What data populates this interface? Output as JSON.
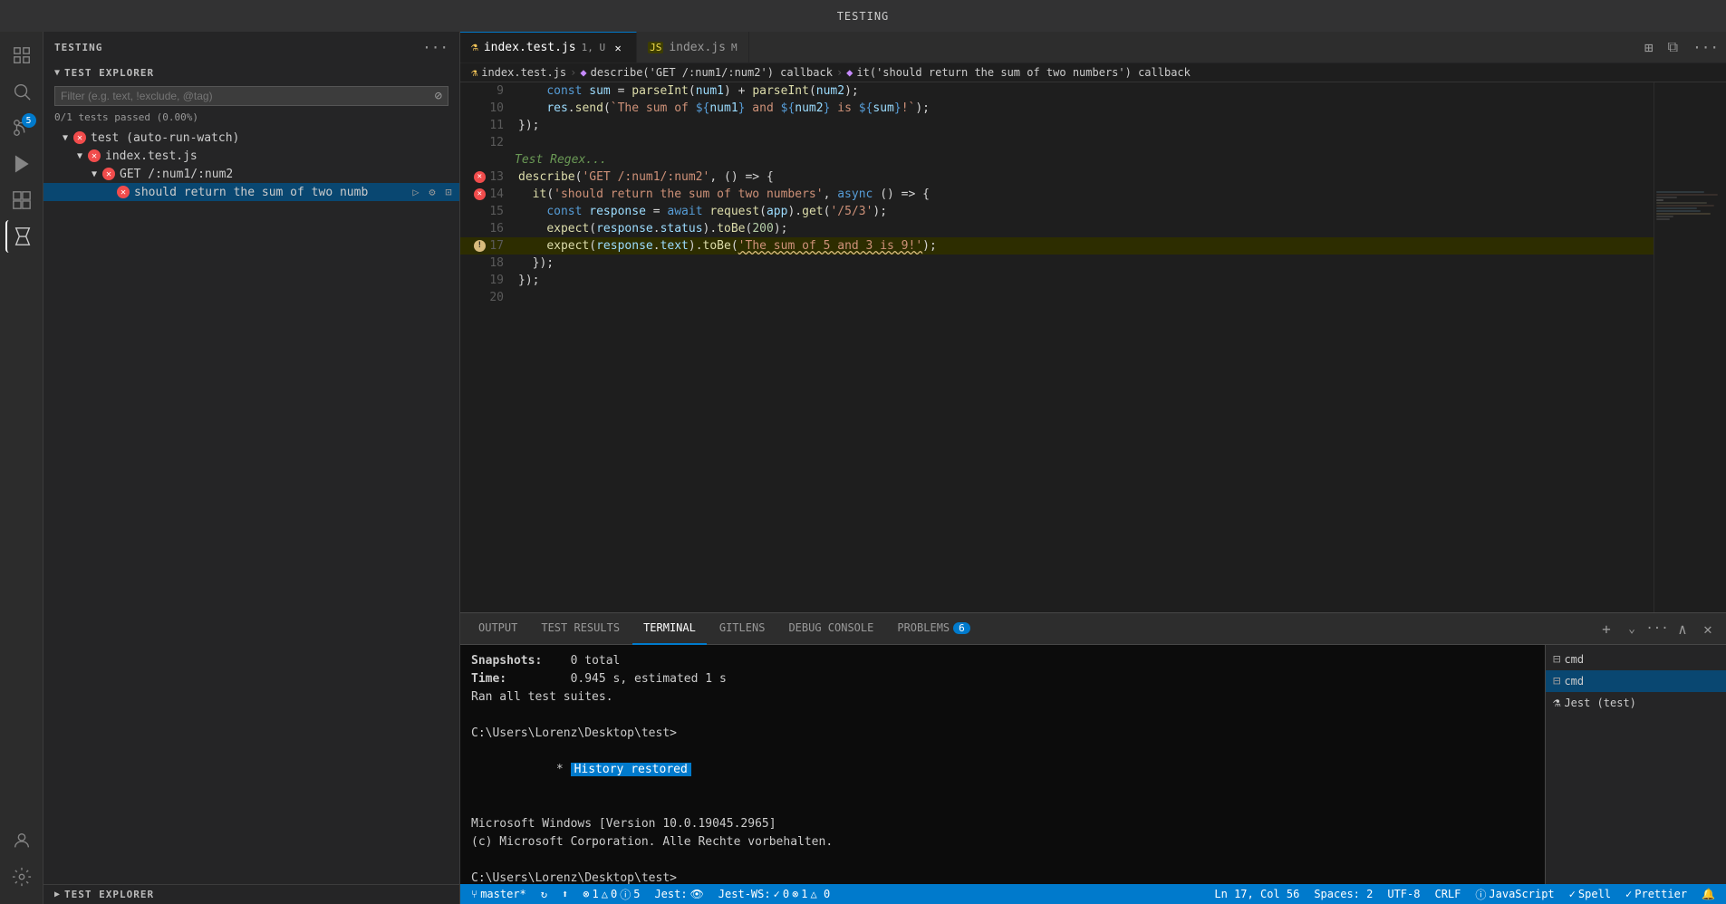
{
  "titleBar": {
    "title": "TESTING"
  },
  "activityBar": {
    "icons": [
      {
        "name": "explorer-icon",
        "symbol": "⬡",
        "active": false
      },
      {
        "name": "search-icon",
        "symbol": "🔍",
        "active": false
      },
      {
        "name": "source-control-icon",
        "symbol": "⑂",
        "active": false
      },
      {
        "name": "debug-icon",
        "symbol": "▷",
        "active": false
      },
      {
        "name": "extensions-icon",
        "symbol": "⊞",
        "active": false
      },
      {
        "name": "testing-icon",
        "symbol": "⚗",
        "active": true
      }
    ],
    "badge": "5"
  },
  "sidebar": {
    "header": "TESTING",
    "testExplorerTitle": "TEST EXPLORER",
    "filterPlaceholder": "Filter (e.g. text, !exclude, @tag)",
    "testStats": "0/1 tests passed (0.00%)",
    "tree": [
      {
        "id": "test-root",
        "label": "test  (auto-run-watch)",
        "level": 1,
        "hasArrow": true,
        "arrowDown": true,
        "hasError": true
      },
      {
        "id": "index-test",
        "label": "index.test.js",
        "level": 2,
        "hasArrow": true,
        "arrowDown": true,
        "hasError": true
      },
      {
        "id": "get-route",
        "label": "GET /:num1/:num2",
        "level": 3,
        "hasArrow": true,
        "arrowDown": true,
        "hasError": true
      },
      {
        "id": "should-return",
        "label": "should return the sum of two numb",
        "level": 4,
        "hasArrow": false,
        "hasError": true,
        "selected": true,
        "hasActions": true
      }
    ],
    "testExplorerFooterTitle": "TEST EXPLORER"
  },
  "tabs": [
    {
      "id": "index-test-tab",
      "label": "index.test.js",
      "dirty": false,
      "modified": true,
      "active": true,
      "icon": "⚗",
      "iconColor": "#f9c859",
      "close": true,
      "badge": "1, U"
    },
    {
      "id": "index-js-tab",
      "label": "index.js",
      "dirty": false,
      "modified": true,
      "active": false,
      "icon": "JS",
      "iconColor": "#f0dc4e",
      "close": false,
      "badge": "M"
    }
  ],
  "breadcrumb": [
    {
      "label": "index.test.js",
      "icon": "⚗"
    },
    {
      "label": "describe('GET /:num1/:num2') callback",
      "icon": "◆"
    },
    {
      "label": "it('should return the sum of two numbers') callback",
      "icon": "◆"
    }
  ],
  "codeLines": [
    {
      "num": 9,
      "content": "    const sum = parseInt(num1) + parseInt(num2);",
      "indicator": null
    },
    {
      "num": 10,
      "content": "    res.send(`The sum of ${num1} and ${num2} is ${sum}!`);",
      "indicator": null
    },
    {
      "num": 11,
      "content": "});",
      "indicator": null
    },
    {
      "num": 12,
      "content": "",
      "indicator": null
    },
    {
      "num": 13,
      "content": "describe('GET /:num1/:num2', () => {",
      "indicator": "error"
    },
    {
      "num": 14,
      "content": "  it('should return the sum of two numbers', async () => {",
      "indicator": "error"
    },
    {
      "num": 15,
      "content": "    const response = await request(app).get('/5/3');",
      "indicator": null
    },
    {
      "num": 16,
      "content": "    expect(response.status).toBe(200);",
      "indicator": null
    },
    {
      "num": 17,
      "content": "    expect(response.text).toBe('The sum of 5 and 3 is 9!');",
      "indicator": "warning"
    },
    {
      "num": 18,
      "content": "  });",
      "indicator": null
    },
    {
      "num": 19,
      "content": "});",
      "indicator": null
    },
    {
      "num": 20,
      "content": "",
      "indicator": null
    }
  ],
  "testRegexComment": "Test Regex...",
  "panel": {
    "tabs": [
      {
        "id": "output",
        "label": "OUTPUT",
        "active": false
      },
      {
        "id": "test-results",
        "label": "TEST RESULTS",
        "active": false
      },
      {
        "id": "terminal",
        "label": "TERMINAL",
        "active": true
      },
      {
        "id": "gitlens",
        "label": "GITLENS",
        "active": false
      },
      {
        "id": "debug-console",
        "label": "DEBUG CONSOLE",
        "active": false
      },
      {
        "id": "problems",
        "label": "PROBLEMS",
        "active": false,
        "badge": "6"
      }
    ],
    "terminal": {
      "lines": [
        {
          "text": "Snapshots:    0 total",
          "type": "normal"
        },
        {
          "text": "Time:         0.945 s, estimated 1 s",
          "type": "normal"
        },
        {
          "text": "Ran all test suites.",
          "type": "normal"
        },
        {
          "text": "",
          "type": "normal"
        },
        {
          "text": "C:\\Users\\Lorenz\\Desktop\\test>",
          "type": "prompt"
        },
        {
          "text": "* History restored",
          "type": "history"
        },
        {
          "text": "",
          "type": "normal"
        },
        {
          "text": "Microsoft Windows [Version 10.0.19045.2965]",
          "type": "normal"
        },
        {
          "text": "(c) Microsoft Corporation. Alle Rechte vorbehalten.",
          "type": "normal"
        },
        {
          "text": "",
          "type": "normal"
        },
        {
          "text": "C:\\Users\\Lorenz\\Desktop\\test>",
          "type": "prompt2"
        }
      ]
    },
    "terminalTabs": [
      {
        "id": "cmd1",
        "label": "cmd",
        "active": false
      },
      {
        "id": "cmd2",
        "label": "cmd",
        "active": true
      },
      {
        "id": "jest",
        "label": "Jest (test)",
        "active": false
      }
    ]
  },
  "statusBar": {
    "left": [
      {
        "id": "branch",
        "icon": "⑂",
        "text": "master*"
      },
      {
        "id": "sync",
        "icon": "↻",
        "text": ""
      },
      {
        "id": "publish",
        "icon": "⬆",
        "text": ""
      },
      {
        "id": "errors",
        "icon": "⊗",
        "text": "1"
      },
      {
        "id": "warnings",
        "icon": "⚠",
        "text": "△ 0"
      },
      {
        "id": "info",
        "icon": "ⓘ",
        "text": "5"
      },
      {
        "id": "jest-status",
        "text": "Jest:"
      },
      {
        "id": "jest-watch",
        "icon": "👁",
        "text": ""
      },
      {
        "id": "jest-ws",
        "text": "Jest-WS:"
      },
      {
        "id": "jest-ws-status",
        "icon": "✓",
        "text": "0"
      },
      {
        "id": "jest-errors",
        "icon": "⊗",
        "text": "1 △ 0"
      }
    ],
    "right": [
      {
        "id": "position",
        "text": "Ln 17, Col 56"
      },
      {
        "id": "spaces",
        "text": "Spaces: 2"
      },
      {
        "id": "encoding",
        "text": "UTF-8"
      },
      {
        "id": "line-ending",
        "text": "CRLF"
      },
      {
        "id": "language",
        "icon": "ⓘ",
        "text": "JavaScript"
      },
      {
        "id": "spell",
        "icon": "✓",
        "text": "Spell"
      },
      {
        "id": "prettier",
        "icon": "✓",
        "text": "Prettier"
      }
    ]
  }
}
